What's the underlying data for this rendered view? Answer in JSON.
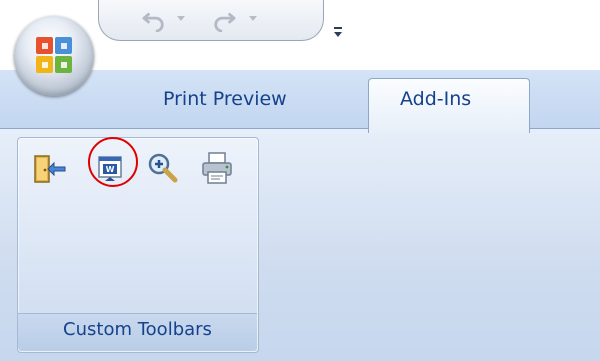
{
  "tabs": [
    {
      "label": "Print Preview",
      "active": false
    },
    {
      "label": "Add-Ins",
      "active": true
    }
  ],
  "qat": {
    "undo_icon": "undo-icon",
    "redo_icon": "redo-icon",
    "customize_icon": "customize-qat-icon"
  },
  "ribbon": {
    "groups": [
      {
        "label": "Custom Toolbars",
        "tools": [
          {
            "icon": "exit-door-icon"
          },
          {
            "icon": "word-document-icon",
            "highlighted": true
          },
          {
            "icon": "zoom-icon"
          },
          {
            "icon": "print-icon"
          }
        ]
      }
    ]
  },
  "colors": {
    "accent_text": "#15428b",
    "highlight": "#e00000",
    "ribbon_bg": "#cfdcef"
  }
}
